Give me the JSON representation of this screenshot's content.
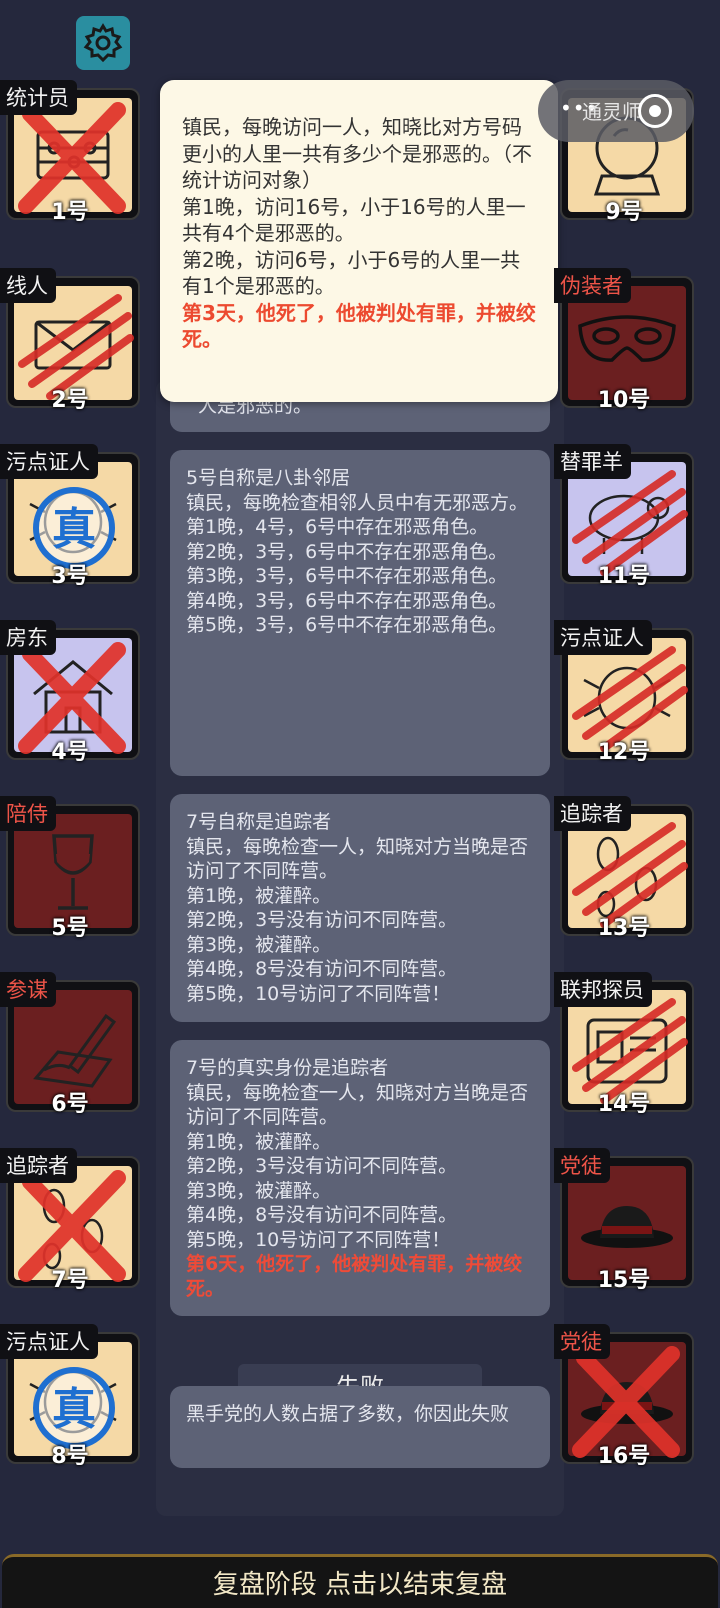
{
  "colors": {
    "background": "#25283d",
    "good_tile": "#f5d9a6",
    "evil_tile": "#6b1f20",
    "lavender_tile": "#c7c4ee",
    "highlight_red": "#ee4b38",
    "settings_teal": "#2a8ea0"
  },
  "top": {
    "settings_icon": "gear-icon",
    "capsule_label": "通灵师"
  },
  "players_left": [
    {
      "role": "统计员",
      "num": "1号",
      "red_role": false,
      "tile": "good",
      "icon": "abacus-icon",
      "status": "x"
    },
    {
      "role": "线人",
      "num": "2号",
      "red_role": false,
      "tile": "good",
      "icon": "envelope-icon",
      "status": "claw"
    },
    {
      "role": "污点证人",
      "num": "3号",
      "red_role": false,
      "tile": "good",
      "icon": "bug-icon",
      "status": "true-stamp"
    },
    {
      "role": "房东",
      "num": "4号",
      "red_role": false,
      "tile": "lav",
      "icon": "house-icon",
      "status": "x"
    },
    {
      "role": "陪侍",
      "num": "5号",
      "red_role": true,
      "tile": "evil",
      "icon": "wine-glass-icon",
      "status": "none"
    },
    {
      "role": "参谋",
      "num": "6号",
      "red_role": true,
      "tile": "evil",
      "icon": "pen-paper-icon",
      "status": "none"
    },
    {
      "role": "追踪者",
      "num": "7号",
      "red_role": false,
      "tile": "good",
      "icon": "footprint-icon",
      "status": "x"
    },
    {
      "role": "污点证人",
      "num": "8号",
      "red_role": false,
      "tile": "good",
      "icon": "bug-icon",
      "status": "true-stamp"
    }
  ],
  "players_right": [
    {
      "role": "通灵师",
      "num": "9号",
      "red_role": false,
      "tile": "good",
      "icon": "crystal-ball-icon",
      "status": "none"
    },
    {
      "role": "伪装者",
      "num": "10号",
      "red_role": true,
      "tile": "evil",
      "icon": "mask-icon",
      "status": "none"
    },
    {
      "role": "替罪羊",
      "num": "11号",
      "red_role": false,
      "tile": "lav",
      "icon": "sheep-icon",
      "status": "claw"
    },
    {
      "role": "污点证人",
      "num": "12号",
      "red_role": false,
      "tile": "good",
      "icon": "bug-icon",
      "status": "claw"
    },
    {
      "role": "追踪者",
      "num": "13号",
      "red_role": false,
      "tile": "good",
      "icon": "footprint-icon",
      "status": "claw"
    },
    {
      "role": "联邦探员",
      "num": "14号",
      "red_role": false,
      "tile": "good",
      "icon": "badge-icon",
      "status": "claw"
    },
    {
      "role": "党徒",
      "num": "15号",
      "red_role": true,
      "tile": "evil",
      "icon": "fedora-icon",
      "status": "none"
    },
    {
      "role": "党徒",
      "num": "16号",
      "red_role": true,
      "tile": "evil",
      "icon": "fedora-icon",
      "status": "x"
    }
  ],
  "popup": {
    "lines": [
      "镇民，每晚访问一人，知晓比对方号码更小的人里一共有多少个是邪恶的。（不统计访问对象）",
      "第1晚，访问16号，小于16号的人里一共有4个是邪恶的。",
      "第2晚，访问6号，小于6号的人里一共有1个是邪恶的。"
    ],
    "death": "第3天，他死了，他被判处有罪，并被绞死。"
  },
  "cards": {
    "partial": "人是邪恶的。",
    "card1": {
      "lines": [
        "5号自称是八卦邻居",
        "镇民，每晚检查相邻人员中有无邪恶方。",
        "第1晚，4号，6号中存在邪恶角色。",
        "第2晚，3号，6号中不存在邪恶角色。",
        "第3晚，3号，6号中不存在邪恶角色。",
        "第4晚，3号，6号中不存在邪恶角色。",
        "第5晚，3号，6号中不存在邪恶角色。"
      ]
    },
    "card2": {
      "lines": [
        "7号自称是追踪者",
        "镇民，每晚检查一人，知晓对方当晚是否访问了不同阵营。",
        "第1晚，被灌醉。",
        "第2晚，3号没有访问不同阵营。",
        "第3晚，被灌醉。",
        "第4晚，8号没有访问不同阵营。",
        "第5晚，10号访问了不同阵营！"
      ]
    },
    "card3": {
      "lines": [
        "7号的真实身份是追踪者",
        "镇民，每晚检查一人，知晓对方当晚是否访问了不同阵营。",
        "第1晚，被灌醉。",
        "第2晚，3号没有访问不同阵营。",
        "第3晚，被灌醉。",
        "第4晚，8号没有访问不同阵营。",
        "第5晚，10号访问了不同阵营！"
      ],
      "death": "第6天，他死了，他被判处有罪，并被绞死。"
    },
    "result_label": "失败",
    "result_text": "黑手党的人数占据了多数，你因此失败"
  },
  "footer": {
    "text": "复盘阶段 点击以结束复盘"
  }
}
